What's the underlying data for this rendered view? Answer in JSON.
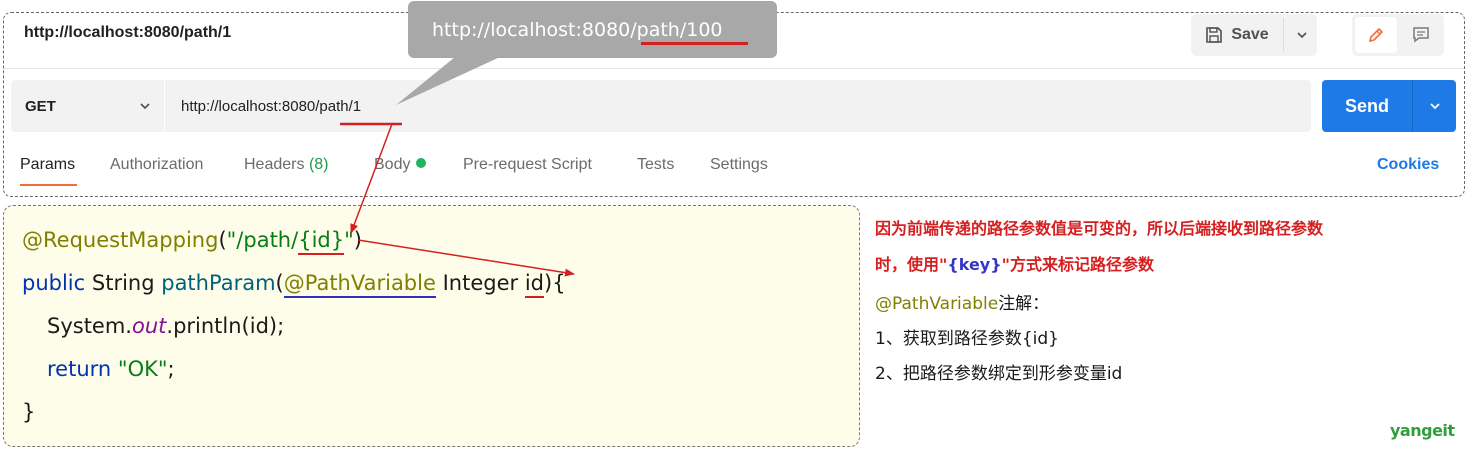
{
  "postman": {
    "tab_title": "http://localhost:8080/path/1",
    "save_label": "Save",
    "request": {
      "method": "GET",
      "url": "http://localhost:8080/path/1"
    },
    "send_label": "Send",
    "tabs": [
      {
        "label": "Params",
        "active": true
      },
      {
        "label": "Authorization"
      },
      {
        "label": "Headers",
        "count": "(8)"
      },
      {
        "label": "Body"
      },
      {
        "label": "Pre-request Script"
      },
      {
        "label": "Tests"
      },
      {
        "label": "Settings"
      }
    ],
    "cookies_label": "Cookies"
  },
  "callout": {
    "prefix": "http://localhost:8080/",
    "highlight": "path/100"
  },
  "code": {
    "line1": {
      "annotation": "@RequestMapping",
      "open": "(",
      "str_prefix": "\"/path/",
      "str_var": "{id}",
      "str_suffix": "\"",
      "close": ")"
    },
    "line2": {
      "keyword": "public",
      "type": "String",
      "method": "pathParam",
      "open": "(",
      "annotation": "@PathVariable",
      "param_type": "Integer",
      "param": "id",
      "close": "){"
    },
    "line3": {
      "prefix": "System.",
      "field": "out",
      "suffix": ".println(id);"
    },
    "line4": {
      "keyword": "return",
      "str": "\"OK\"",
      "end": ";"
    },
    "line5": "}"
  },
  "explanation": {
    "line1": "因为前端传递的路径参数值是可变的，所以后端接收到路径参数",
    "line2_prefix": "时，使用\"",
    "line2_key": "{key}",
    "line2_suffix": "\"方式来标记路径参数",
    "anno_name": "@PathVariable",
    "anno_suffix": "注解：",
    "item1": "1、获取到路径参数{id}",
    "item2": "2、把路径参数绑定到形参变量id"
  },
  "watermark": "yangeit",
  "colors": {
    "send_blue": "#1e7ae6",
    "active_tab_underline": "#f26b3a",
    "highlight_red": "#d42020",
    "code_background": "#fefde9"
  }
}
